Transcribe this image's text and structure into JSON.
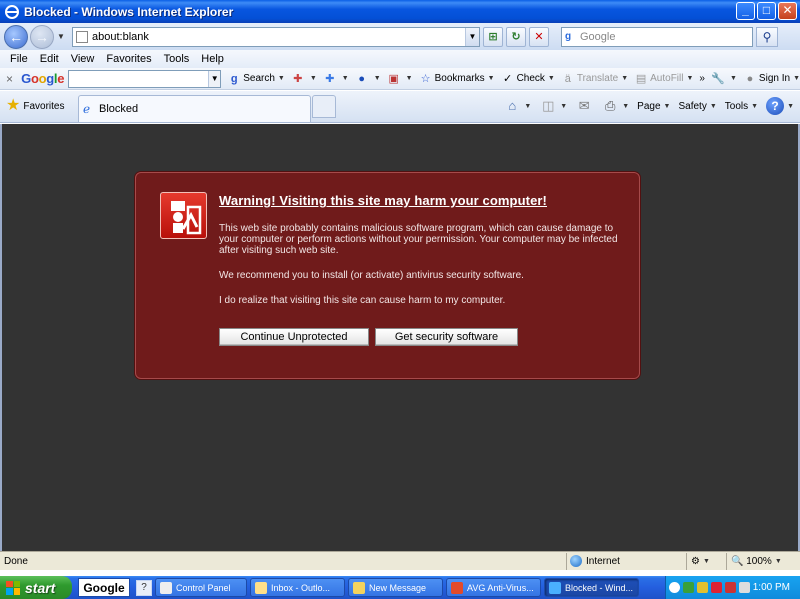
{
  "window": {
    "title": "Blocked - Windows Internet Explorer",
    "minimize": "_",
    "maximize": "□",
    "close": "✕"
  },
  "address_bar": {
    "url": "about:blank",
    "search_placeholder": "Google"
  },
  "menu": [
    "File",
    "Edit",
    "View",
    "Favorites",
    "Tools",
    "Help"
  ],
  "google_toolbar": {
    "logo": {
      "c1": "G",
      "c2": "o",
      "c3": "o",
      "c4": "g",
      "c5": "l",
      "c6": "e"
    },
    "buttons": {
      "search": "Search",
      "bookmarks": "Bookmarks",
      "check": "Check",
      "translate": "Translate",
      "autofill": "AutoFill",
      "more": "»",
      "signin": "Sign In"
    }
  },
  "tabs": {
    "favorites": "Favorites",
    "current_tab": "Blocked"
  },
  "command_bar": {
    "page": "Page",
    "safety": "Safety",
    "tools": "Tools"
  },
  "warning": {
    "title": "Warning! Visiting this site may harm your computer!",
    "para1": "This web site probably contains malicious software program, which can cause damage to your computer or perform actions without your permission. Your computer may be infected after visiting such web site.",
    "para2": "We recommend you to install (or activate) antivirus security software.",
    "para3": "I do realize that visiting this site can cause harm to my computer.",
    "button_continue": "Continue Unprotected",
    "button_get": "Get security software"
  },
  "status_bar": {
    "text": "Done",
    "zone": "Internet",
    "zoom": "100%"
  },
  "taskbar": {
    "start": "start",
    "google": "Google",
    "tasks": [
      {
        "label": "Control Panel"
      },
      {
        "label": "Inbox - Outlo..."
      },
      {
        "label": "New Message"
      },
      {
        "label": "AVG Anti-Virus..."
      },
      {
        "label": "Blocked - Wind..."
      }
    ],
    "clock": "1:00 PM"
  },
  "colors": {
    "warning_bg": "#701b1b",
    "content_bg": "#333333",
    "title_bar": "#0856e0"
  }
}
